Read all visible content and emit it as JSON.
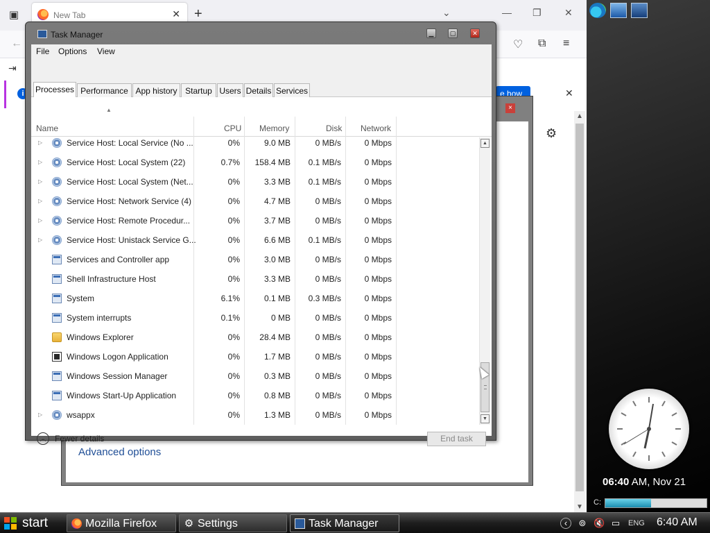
{
  "firefox": {
    "tab_title": "New Tab",
    "notice_button": "e how",
    "colors": {
      "tabbar": "#f0f0f4",
      "accent": "#0061e0"
    }
  },
  "settings": {
    "advanced_options": "Advanced options",
    "close_glyph": "×"
  },
  "task_manager": {
    "title": "Task Manager",
    "menu": [
      "File",
      "Options",
      "View"
    ],
    "tabs": [
      "Processes",
      "Performance",
      "App history",
      "Startup",
      "Users",
      "Details",
      "Services"
    ],
    "active_tab": "Processes",
    "columns": {
      "name": "Name",
      "cpu": "CPU",
      "memory": "Memory",
      "disk": "Disk",
      "network": "Network"
    },
    "rows": [
      {
        "expand": true,
        "icon": "gear-icon",
        "name": "Service Host: Local Service (No ...",
        "cpu": "0%",
        "memory": "9.0 MB",
        "disk": "0 MB/s",
        "network": "0 Mbps"
      },
      {
        "expand": true,
        "icon": "gear-icon",
        "name": "Service Host: Local System (22)",
        "cpu": "0.7%",
        "memory": "158.4 MB",
        "disk": "0.1 MB/s",
        "network": "0 Mbps"
      },
      {
        "expand": true,
        "icon": "gear-icon",
        "name": "Service Host: Local System (Net...",
        "cpu": "0%",
        "memory": "3.3 MB",
        "disk": "0.1 MB/s",
        "network": "0 Mbps"
      },
      {
        "expand": true,
        "icon": "gear-icon",
        "name": "Service Host: Network Service (4)",
        "cpu": "0%",
        "memory": "4.7 MB",
        "disk": "0 MB/s",
        "network": "0 Mbps"
      },
      {
        "expand": true,
        "icon": "gear-icon",
        "name": "Service Host: Remote Procedur...",
        "cpu": "0%",
        "memory": "3.7 MB",
        "disk": "0 MB/s",
        "network": "0 Mbps"
      },
      {
        "expand": true,
        "icon": "gear-icon",
        "name": "Service Host: Unistack Service G...",
        "cpu": "0%",
        "memory": "6.6 MB",
        "disk": "0.1 MB/s",
        "network": "0 Mbps"
      },
      {
        "expand": false,
        "icon": "window-icon",
        "name": "Services and Controller app",
        "cpu": "0%",
        "memory": "3.0 MB",
        "disk": "0 MB/s",
        "network": "0 Mbps"
      },
      {
        "expand": false,
        "icon": "window-icon",
        "name": "Shell Infrastructure Host",
        "cpu": "0%",
        "memory": "3.3 MB",
        "disk": "0 MB/s",
        "network": "0 Mbps"
      },
      {
        "expand": false,
        "icon": "window-icon",
        "name": "System",
        "cpu": "6.1%",
        "memory": "0.1 MB",
        "disk": "0.3 MB/s",
        "network": "0 Mbps"
      },
      {
        "expand": false,
        "icon": "window-icon",
        "name": "System interrupts",
        "cpu": "0.1%",
        "memory": "0 MB",
        "disk": "0 MB/s",
        "network": "0 Mbps"
      },
      {
        "expand": false,
        "icon": "folder-icon",
        "name": "Windows Explorer",
        "cpu": "0%",
        "memory": "28.4 MB",
        "disk": "0 MB/s",
        "network": "0 Mbps"
      },
      {
        "expand": false,
        "icon": "terminal-icon",
        "name": "Windows Logon Application",
        "cpu": "0%",
        "memory": "1.7 MB",
        "disk": "0 MB/s",
        "network": "0 Mbps"
      },
      {
        "expand": false,
        "icon": "window-icon",
        "name": "Windows Session Manager",
        "cpu": "0%",
        "memory": "0.3 MB",
        "disk": "0 MB/s",
        "network": "0 Mbps"
      },
      {
        "expand": false,
        "icon": "window-icon",
        "name": "Windows Start-Up Application",
        "cpu": "0%",
        "memory": "0.8 MB",
        "disk": "0 MB/s",
        "network": "0 Mbps"
      },
      {
        "expand": true,
        "icon": "gear-icon",
        "name": "wsappx",
        "cpu": "0%",
        "memory": "1.3 MB",
        "disk": "0 MB/s",
        "network": "0 Mbps"
      }
    ],
    "fewer_details": "Fewer details",
    "end_task": "End task"
  },
  "sidebar": {
    "clock_time": "06:40",
    "clock_rest": " AM, Nov 21",
    "drive_label": "C:",
    "drive_usage": 0.45
  },
  "taskbar": {
    "start_label": "start",
    "buttons": [
      {
        "label": "Mozilla Firefox",
        "icon": "firefox-icon",
        "active": false
      },
      {
        "label": "Settings",
        "icon": "gear-icon",
        "active": false
      },
      {
        "label": "Task Manager",
        "icon": "task-manager-icon",
        "active": true
      }
    ],
    "lang": "ENG",
    "time": "6:40 AM"
  }
}
